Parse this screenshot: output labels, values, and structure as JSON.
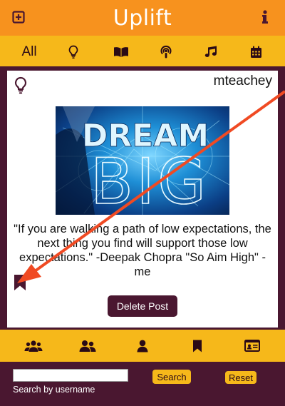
{
  "app": {
    "title": "Uplift"
  },
  "header": {
    "add_icon": "plus-square-icon",
    "info_icon": "info-icon"
  },
  "filters": {
    "all_label": "All",
    "icons": [
      "lightbulb-icon",
      "book-icon",
      "podcast-icon",
      "music-icon",
      "calendar-icon"
    ]
  },
  "post": {
    "username": "mteachey",
    "image_text": {
      "line1": "DREAM",
      "line2": "BIG"
    },
    "quote": "\"If you are walking a path of low expectations, the next thing you find will support those low expectations.\" -Deepak Chopra \"So Aim High\" -me",
    "delete_label": "Delete Post"
  },
  "nav": {
    "icons": [
      "users-icon",
      "user-friends-icon",
      "user-icon",
      "bookmark-icon",
      "id-card-icon"
    ]
  },
  "footer": {
    "search_placeholder": "",
    "search_value": "",
    "search_label": "Search by username",
    "search_button": "Search",
    "reset_button": "Reset"
  },
  "colors": {
    "orange": "#f7921e",
    "gold": "#f6b81a",
    "maroon": "#4a1730",
    "arrow": "#f04a23"
  }
}
